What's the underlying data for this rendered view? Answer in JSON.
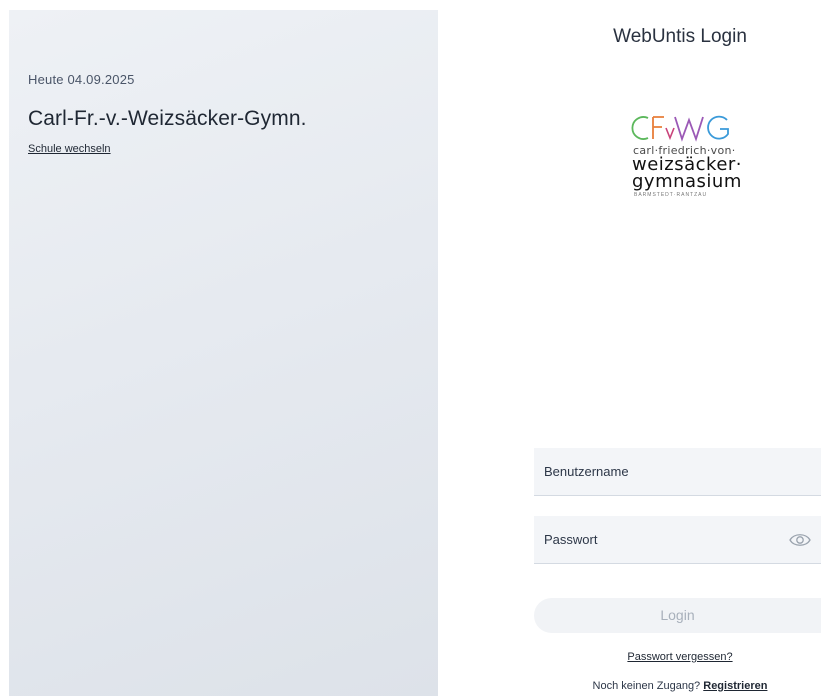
{
  "left": {
    "date": "Heute 04.09.2025",
    "school_name": "Carl-Fr.-v.-Weizsäcker-Gymn.",
    "switch_school": "Schule wechseln"
  },
  "header": {
    "title": "WebUntis Login"
  },
  "logo": {
    "letters": "CFvWG",
    "line1": "carl·friedrich·von·",
    "line2": "weizsäcker·",
    "line3": "gymnasium",
    "line4": "BARMSTEDT·RANTZAU",
    "colors": [
      "#e8b33a",
      "#c9437a",
      "#3a9ad9",
      "#5cb85c",
      "#9b59b6"
    ]
  },
  "form": {
    "username_label": "Benutzername",
    "password_label": "Passwort",
    "login_label": "Login",
    "forgot_password": "Passwort vergessen?",
    "no_access_text": "Noch keinen Zugang?",
    "register_link": "Registrieren",
    "eye_icon": "eye-icon"
  }
}
